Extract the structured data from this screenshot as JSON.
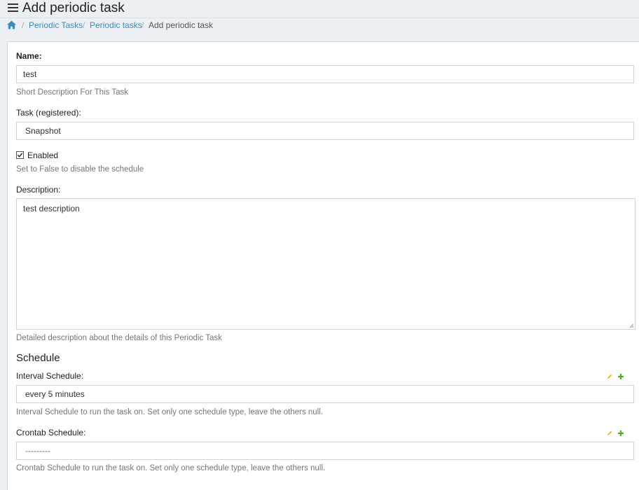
{
  "header": {
    "title": "Add periodic task"
  },
  "breadcrumb": {
    "separator": "/",
    "items": [
      "Periodic Tasks",
      "Periodic tasks"
    ],
    "current": "Add periodic task"
  },
  "form": {
    "name": {
      "label": "Name:",
      "value": "test",
      "help": "Short Description For This Task"
    },
    "task": {
      "label": "Task (registered):",
      "value": "Snapshot"
    },
    "enabled": {
      "label": "Enabled",
      "checked": true,
      "help": "Set to False to disable the schedule"
    },
    "description": {
      "label": "Description:",
      "value": "test description",
      "help": "Detailed description about the details of this Periodic Task"
    },
    "schedule_section": "Schedule",
    "interval": {
      "label": "Interval Schedule:",
      "value": "every 5 minutes",
      "help": "Interval Schedule to run the task on.  Set only one schedule type, leave the others null."
    },
    "crontab": {
      "label": "Crontab Schedule:",
      "value": "---------",
      "help": "Crontab Schedule to run the task on.  Set only one schedule type, leave the others null."
    }
  },
  "icons": {
    "menu": "hamburger-icon",
    "home": "home-icon",
    "edit": "pencil-icon",
    "add": "plus-icon"
  },
  "colors": {
    "link": "#3c8dbc",
    "edit_icon": "#e8b800",
    "add_icon": "#56a929",
    "background": "#ecf0f5"
  }
}
